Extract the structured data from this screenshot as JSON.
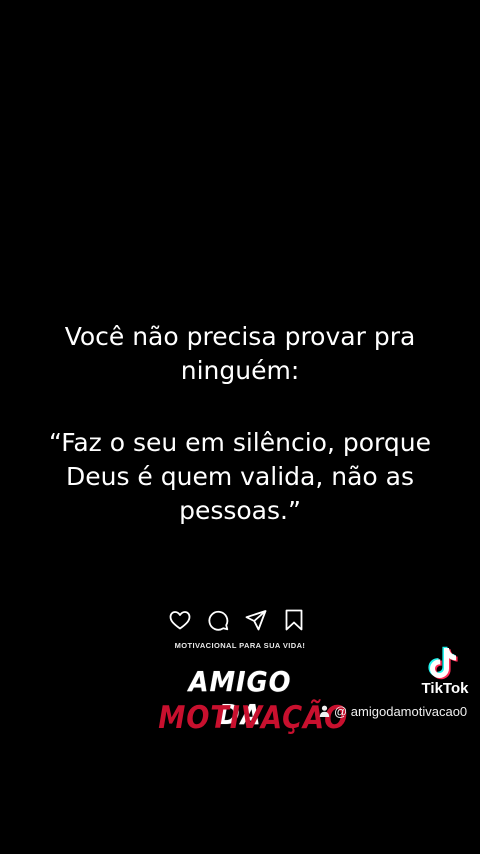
{
  "quote": {
    "intro_lines": [
      "Você não precisa provar pra",
      "ninguém:"
    ],
    "body_lines": [
      "“Faz o seu em silêncio, porque",
      "Deus é quem valida, não as",
      "pessoas.”"
    ]
  },
  "post_actions": {
    "icons": [
      "heart-icon",
      "comment-icon",
      "send-icon",
      "bookmark-icon"
    ]
  },
  "brand": {
    "tagline": "MOTIVACIONAL PARA SUA VIDA!",
    "logo_line1": "AMIGO DA",
    "logo_line2": "MOTIVAÇÃO",
    "logo_color_primary": "#ffffff",
    "logo_color_accent": "#c8102e"
  },
  "watermark": {
    "app_name": "TikTok",
    "handle": "@ amigodamotivacao0",
    "icon": "tiktok-note-icon"
  }
}
